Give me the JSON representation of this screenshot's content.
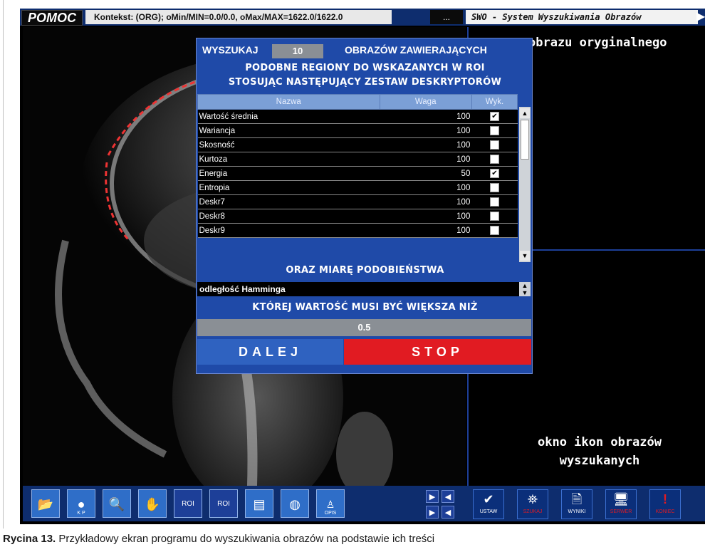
{
  "topbar": {
    "help_button": "POMOC",
    "context": "Kontekst: (ORG); oMin/MIN=0.0/0.0, oMax/MAX=1622.0/1622.0",
    "ellipsis_button": "...",
    "app_title": "SWO - System Wyszukiwania Obrazów"
  },
  "panels": {
    "original_title": "obrazu oryginalnego",
    "results_title": "okno ikon obrazów wyszukanych"
  },
  "dialog": {
    "search_label": "WYSZUKAJ",
    "search_count": "10",
    "images_label": "OBRAZÓW ZAWIERAJĄCYCH",
    "line2": "PODOBNE REGIONY DO WSKAZANYCH W ROI",
    "line3": "STOSUJĄC NASTĘPUJĄCY ZESTAW DESKRYPTORÓW",
    "columns": [
      "Nazwa",
      "Waga",
      "Wyk."
    ],
    "rows": [
      {
        "name": "Wartość średnia",
        "weight": "100",
        "checked": true
      },
      {
        "name": "Wariancja",
        "weight": "100",
        "checked": false
      },
      {
        "name": "Skosność",
        "weight": "100",
        "checked": false
      },
      {
        "name": "Kurtoza",
        "weight": "100",
        "checked": false
      },
      {
        "name": "Energia",
        "weight": "50",
        "checked": true
      },
      {
        "name": "Entropia",
        "weight": "100",
        "checked": false
      },
      {
        "name": "Deskr7",
        "weight": "100",
        "checked": false
      },
      {
        "name": "Deskr8",
        "weight": "100",
        "checked": false
      },
      {
        "name": "Deskr9",
        "weight": "100",
        "checked": false
      }
    ],
    "metric_header": "ORAZ MIARĘ PODOBIEŃSTWA",
    "metric_value": "odległość Hamminga",
    "threshold_header": "KTÓREJ WARTOŚĆ MUSI BYĆ WIĘKSZA NIŻ",
    "threshold_value": "0.5",
    "next_button": "DALEJ",
    "stop_button": "STOP"
  },
  "toolbar": {
    "left_tools": [
      {
        "icon": "folder-open-icon",
        "label": ""
      },
      {
        "icon": "brain-kp-icon",
        "label": "K    P"
      },
      {
        "icon": "zoom-icon",
        "label": ""
      },
      {
        "icon": "hand-icon",
        "label": ""
      },
      {
        "icon": "roi-icon",
        "label": "ROI"
      },
      {
        "icon": "roi-parameters-icon",
        "label": "ROI"
      },
      {
        "icon": "image-stack-icon",
        "label": ""
      },
      {
        "icon": "brain-slice-icon",
        "label": ""
      },
      {
        "icon": "opis-icon",
        "label": "OPIS"
      }
    ],
    "right_tools": [
      {
        "icon": "check-icon",
        "label": "USTAW",
        "color": "#ffffff"
      },
      {
        "icon": "binoculars-icon",
        "label": "SZUKAJ",
        "color": "#e11b22"
      },
      {
        "icon": "results-icon",
        "label": "WYNIKI",
        "color": "#ffffff"
      },
      {
        "icon": "server-icon",
        "label": "SERWER",
        "color": "#e11b22"
      },
      {
        "icon": "exit-icon",
        "label": "KONIEC",
        "color": "#e11b22"
      }
    ]
  },
  "caption": {
    "label": "Rycina 13.",
    "text": "Przykładowy ekran programu do wyszukiwania obrazów na podstawie ich treści"
  }
}
